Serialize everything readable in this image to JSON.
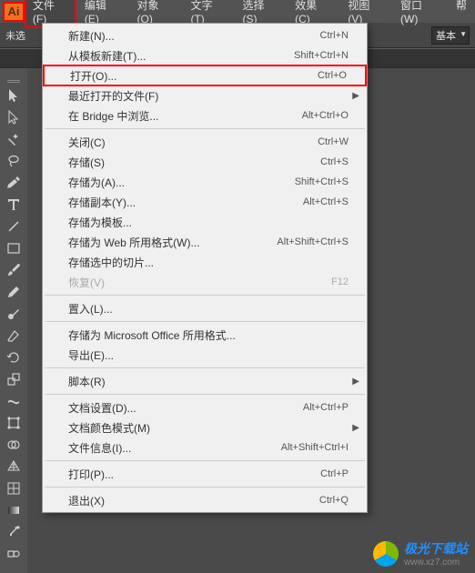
{
  "app": {
    "icon_label": "Ai"
  },
  "menubar": {
    "items": [
      {
        "label": "文件(F)",
        "active": true
      },
      {
        "label": "编辑(E)"
      },
      {
        "label": "对象(O)"
      },
      {
        "label": "文字(T)"
      },
      {
        "label": "选择(S)"
      },
      {
        "label": "效果(C)"
      },
      {
        "label": "视图(V)"
      },
      {
        "label": "窗口(W)"
      },
      {
        "label": "帮"
      }
    ]
  },
  "options": {
    "left_label": "未选",
    "right_label": "基本"
  },
  "file_menu": [
    {
      "type": "item",
      "label": "新建(N)...",
      "shortcut": "Ctrl+N"
    },
    {
      "type": "item",
      "label": "从模板新建(T)...",
      "shortcut": "Shift+Ctrl+N"
    },
    {
      "type": "item",
      "label": "打开(O)...",
      "shortcut": "Ctrl+O",
      "highlighted": true
    },
    {
      "type": "item",
      "label": "最近打开的文件(F)",
      "submenu": true
    },
    {
      "type": "item",
      "label": "在 Bridge 中浏览...",
      "shortcut": "Alt+Ctrl+O"
    },
    {
      "type": "sep"
    },
    {
      "type": "item",
      "label": "关闭(C)",
      "shortcut": "Ctrl+W"
    },
    {
      "type": "item",
      "label": "存储(S)",
      "shortcut": "Ctrl+S"
    },
    {
      "type": "item",
      "label": "存储为(A)...",
      "shortcut": "Shift+Ctrl+S"
    },
    {
      "type": "item",
      "label": "存储副本(Y)...",
      "shortcut": "Alt+Ctrl+S"
    },
    {
      "type": "item",
      "label": "存储为模板..."
    },
    {
      "type": "item",
      "label": "存储为 Web 所用格式(W)...",
      "shortcut": "Alt+Shift+Ctrl+S"
    },
    {
      "type": "item",
      "label": "存储选中的切片..."
    },
    {
      "type": "item",
      "label": "恢复(V)",
      "shortcut": "F12",
      "disabled": true
    },
    {
      "type": "sep"
    },
    {
      "type": "item",
      "label": "置入(L)..."
    },
    {
      "type": "sep"
    },
    {
      "type": "item",
      "label": "存储为 Microsoft Office 所用格式..."
    },
    {
      "type": "item",
      "label": "导出(E)..."
    },
    {
      "type": "sep"
    },
    {
      "type": "item",
      "label": "脚本(R)",
      "submenu": true
    },
    {
      "type": "sep"
    },
    {
      "type": "item",
      "label": "文档设置(D)...",
      "shortcut": "Alt+Ctrl+P"
    },
    {
      "type": "item",
      "label": "文档颜色模式(M)",
      "submenu": true
    },
    {
      "type": "item",
      "label": "文件信息(I)...",
      "shortcut": "Alt+Shift+Ctrl+I"
    },
    {
      "type": "sep"
    },
    {
      "type": "item",
      "label": "打印(P)...",
      "shortcut": "Ctrl+P"
    },
    {
      "type": "sep"
    },
    {
      "type": "item",
      "label": "退出(X)",
      "shortcut": "Ctrl+Q"
    }
  ],
  "watermark": {
    "title": "极光下载站",
    "url": "www.xz7.com"
  }
}
